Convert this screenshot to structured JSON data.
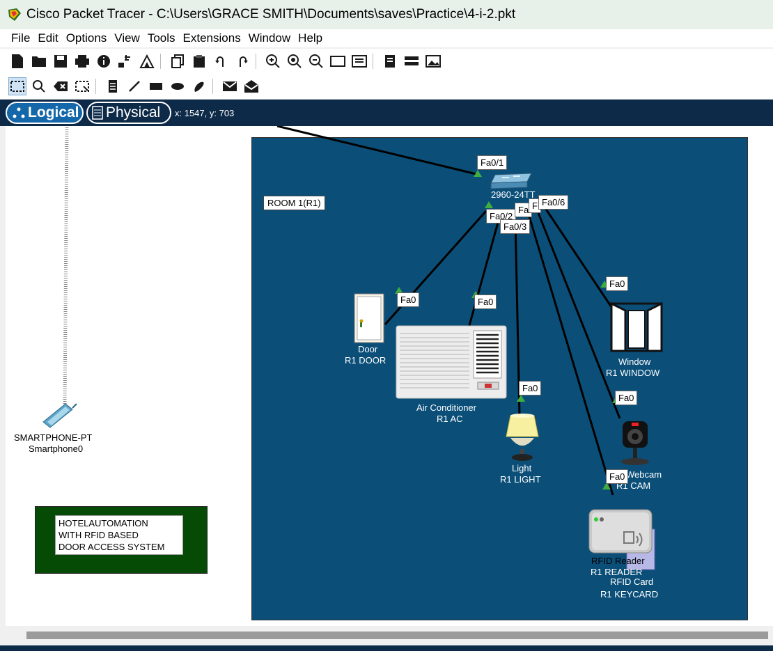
{
  "window": {
    "title": "Cisco Packet Tracer - C:\\Users\\GRACE SMITH\\Documents\\saves\\Practice\\4-i-2.pkt"
  },
  "menu": [
    "File",
    "Edit",
    "Options",
    "View",
    "Tools",
    "Extensions",
    "Window",
    "Help"
  ],
  "toolbar_main": [
    "new-icon",
    "open-icon",
    "save-icon",
    "print-icon",
    "info-icon",
    "network-wizard-icon",
    "activity-wizard-icon",
    "copy-icon",
    "paste-icon",
    "undo-icon",
    "redo-icon",
    "zoom-in-icon",
    "zoom-reset-icon",
    "zoom-out-icon",
    "drawing-palette-icon",
    "custom-device-icon",
    "pdu-list-icon",
    "viewport-icon",
    "image-icon"
  ],
  "toolbar_tools": [
    "select-icon",
    "inspect-icon",
    "delete-icon",
    "resize-icon",
    "note-icon",
    "line-icon",
    "rectangle-icon",
    "ellipse-icon",
    "freeform-icon",
    "simple-pdu-icon",
    "complex-pdu-icon"
  ],
  "tabs": {
    "logical": "Logical",
    "physical": "Physical"
  },
  "coords": "x: 1547, y: 703",
  "room_label": "ROOM 1(R1)",
  "note": {
    "line1": "HOTELAUTOMATION",
    "line2": "WITH RFID BASED",
    "line3": "DOOR ACCESS SYSTEM"
  },
  "devices": {
    "smartphone": {
      "type": "SMARTPHONE-PT",
      "name": "Smartphone0"
    },
    "switch": {
      "type": "2960-24TT"
    },
    "door": {
      "type": "Door",
      "name": "R1 DOOR"
    },
    "ac": {
      "type": "Air Conditioner",
      "name": "R1 AC"
    },
    "light": {
      "type": "Light",
      "name": "R1 LIGHT"
    },
    "window": {
      "type": "Window",
      "name": "R1 WINDOW"
    },
    "webcam": {
      "type": "Webcam",
      "name": "R1 CAM"
    },
    "rfid_reader": {
      "type": "RFID Reader",
      "name": "R1 READER"
    },
    "rfid_card": {
      "type": "RFID Card",
      "name": "R1 KEYCARD"
    }
  },
  "ports": {
    "uplink": "Fa0/1",
    "sw_door": "Fa0/2",
    "sw_ac": "Fa0/3",
    "sw_c": "Fa",
    "sw_d": "F",
    "sw_window": "Fa0/6",
    "door": "Fa0",
    "ac": "Fa0",
    "light": "Fa0",
    "window": "Fa0",
    "webcam": "Fa0",
    "reader": "Fa0"
  },
  "colors": {
    "room_bg": "#0b4f79",
    "tab_bar": "#0e2a49",
    "tab_active": "#1467a8",
    "note_bg": "#054b06",
    "link_up": "#3fae3f"
  }
}
